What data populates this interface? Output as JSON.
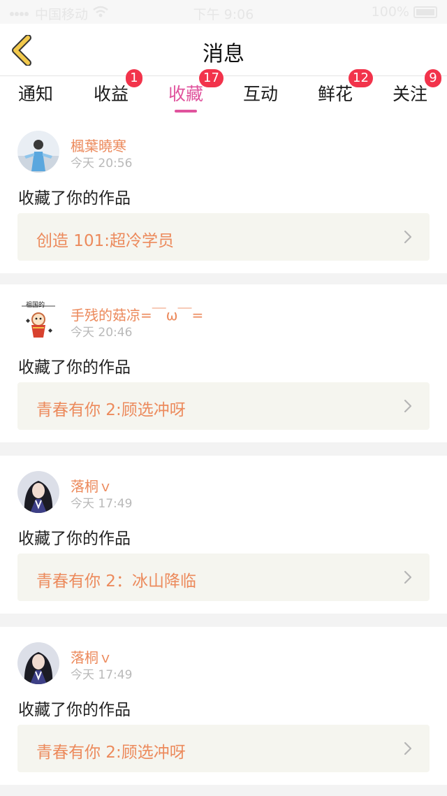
{
  "status_bar": {
    "carrier": "中国移动",
    "time": "下午 9:06",
    "battery": "100%"
  },
  "header": {
    "title": "消息"
  },
  "tabs": [
    {
      "label": "通知",
      "badge": "",
      "active": false
    },
    {
      "label": "收益",
      "badge": "1",
      "active": false
    },
    {
      "label": "收藏",
      "badge": "17",
      "active": true
    },
    {
      "label": "互动",
      "badge": "",
      "active": false
    },
    {
      "label": "鲜花",
      "badge": "12",
      "active": false
    },
    {
      "label": "关注",
      "badge": "9",
      "active": false
    }
  ],
  "notifications": [
    {
      "username": "楓葉曉寒",
      "time": "今天 20:56",
      "message": "收藏了你的作品",
      "work_title": "创造 101:超冷学员",
      "avatar_icon": "user-avatar-icon"
    },
    {
      "username": "手残的菇凉=￣ω￣=",
      "time": "今天 20:46",
      "message": "收藏了你的作品",
      "work_title": "青春有你 2:顾选冲呀",
      "avatar_icon": "user-avatar-icon",
      "avatar_text": "祖国的"
    },
    {
      "username": "落桐ｖ",
      "time": "今天 17:49",
      "message": "收藏了你的作品",
      "work_title": "青春有你 2：冰山降临",
      "avatar_icon": "user-avatar-icon"
    },
    {
      "username": "落桐ｖ",
      "time": "今天 17:49",
      "message": "收藏了你的作品",
      "work_title": "青春有你 2:顾选冲呀",
      "avatar_icon": "user-avatar-icon"
    }
  ],
  "colors": {
    "accent_pink": "#e0539d",
    "username_orange": "#ec8a5c",
    "badge_red": "#f2334b",
    "back_arrow_yellow": "#f2c94c"
  }
}
